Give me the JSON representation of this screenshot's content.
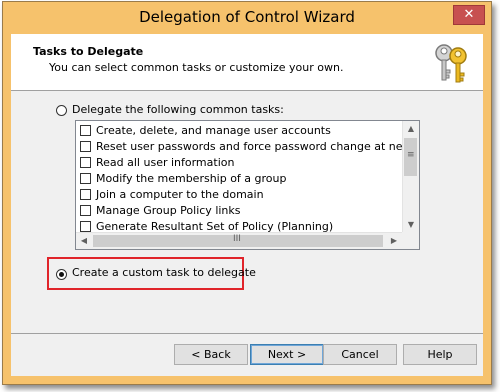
{
  "window": {
    "title": "Delegation of Control Wizard",
    "close_label": "✕"
  },
  "header": {
    "title": "Tasks to Delegate",
    "subtitle": "You can select common tasks or customize your own."
  },
  "options": {
    "common_label": "Delegate the following common tasks:",
    "common_selected": false,
    "custom_label": "Create a custom task to delegate",
    "custom_selected": true
  },
  "tasks": [
    {
      "label": "Create, delete, and manage user accounts",
      "checked": false
    },
    {
      "label": "Reset user passwords and force password change at next logon",
      "checked": false
    },
    {
      "label": "Read all user information",
      "checked": false
    },
    {
      "label": "Modify the membership of a group",
      "checked": false
    },
    {
      "label": "Join a computer to the domain",
      "checked": false
    },
    {
      "label": "Manage Group Policy links",
      "checked": false
    },
    {
      "label": "Generate Resultant Set of Policy (Planning)",
      "checked": false
    }
  ],
  "buttons": {
    "back": "< Back",
    "next": "Next >",
    "cancel": "Cancel",
    "help": "Help"
  },
  "icons": {
    "wizard": "keys-icon",
    "close": "close-icon",
    "scroll_up": "arrow-up-icon",
    "scroll_down": "arrow-down-icon",
    "scroll_left": "arrow-left-icon",
    "scroll_right": "arrow-right-icon"
  },
  "colors": {
    "title_bar": "#f6c26c",
    "close_button": "#c75050",
    "highlight": "#e0242a"
  }
}
